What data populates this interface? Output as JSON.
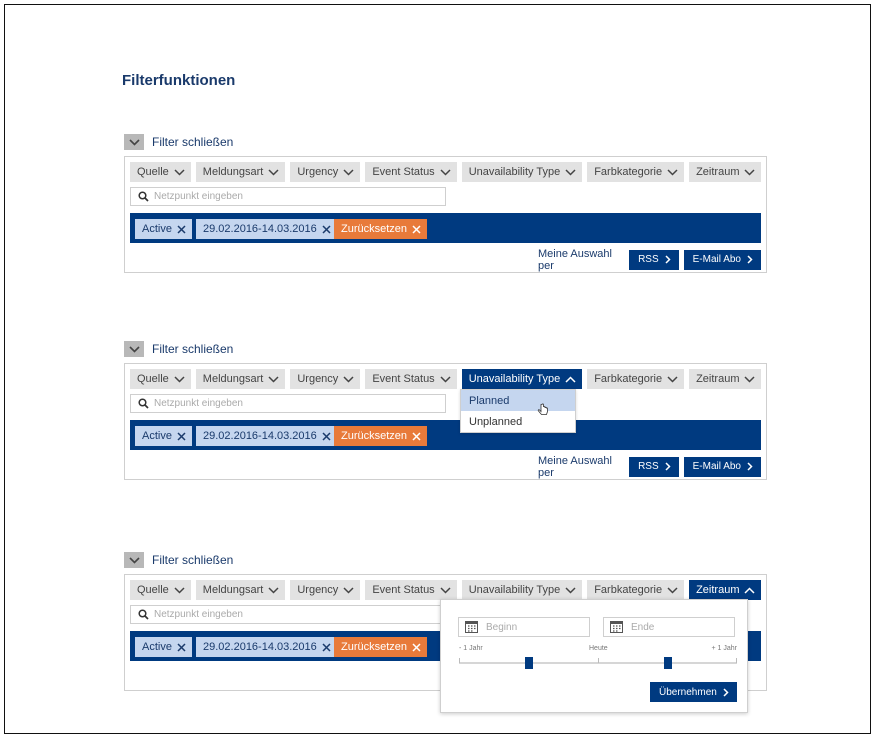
{
  "page": {
    "title": "Filterfunktionen"
  },
  "colors": {
    "primary": "#003a80",
    "chip": "#c5d6ef",
    "reset": "#e87a3a",
    "tab": "#e2e2e2"
  },
  "icons": {
    "toggle": "chevron-down-icon",
    "tab": "chevron-down-icon",
    "tab_open": "chevron-up-icon",
    "search": "search-icon",
    "remove": "close-icon",
    "button": "chevron-right-icon",
    "calendar": "calendar-icon",
    "cursor": "hand-cursor-icon"
  },
  "filter": {
    "toggle_label": "Filter schließen",
    "tabs": [
      "Quelle",
      "Meldungsart",
      "Urgency",
      "Event Status",
      "Unavailability Type",
      "Farbkategorie",
      "Zeitraum"
    ],
    "search_placeholder": "Netzpunkt eingeben",
    "chips": {
      "status": "Active",
      "daterange": "29.02.2016-14.03.2016",
      "reset": "Zurücksetzen"
    },
    "footer_text": "Meine Auswahl per",
    "rss_label": "RSS",
    "email_label": "E-Mail Abo"
  },
  "panels": [
    {
      "open_tab": null
    },
    {
      "open_tab": "Unavailability Type"
    },
    {
      "open_tab": "Zeitraum"
    }
  ],
  "unavailability_dropdown": {
    "options": [
      "Planned",
      "Unplanned"
    ],
    "highlighted": "Planned"
  },
  "zeitraum_popup": {
    "begin_placeholder": "Beginn",
    "end_placeholder": "Ende",
    "scale_min_label": "- 1 Jahr",
    "scale_mid_label": "Heute",
    "scale_max_label": "+ 1 Jahr",
    "apply_label": "Übernehmen",
    "range_start_fraction": 0.25,
    "range_end_fraction": 0.75
  }
}
